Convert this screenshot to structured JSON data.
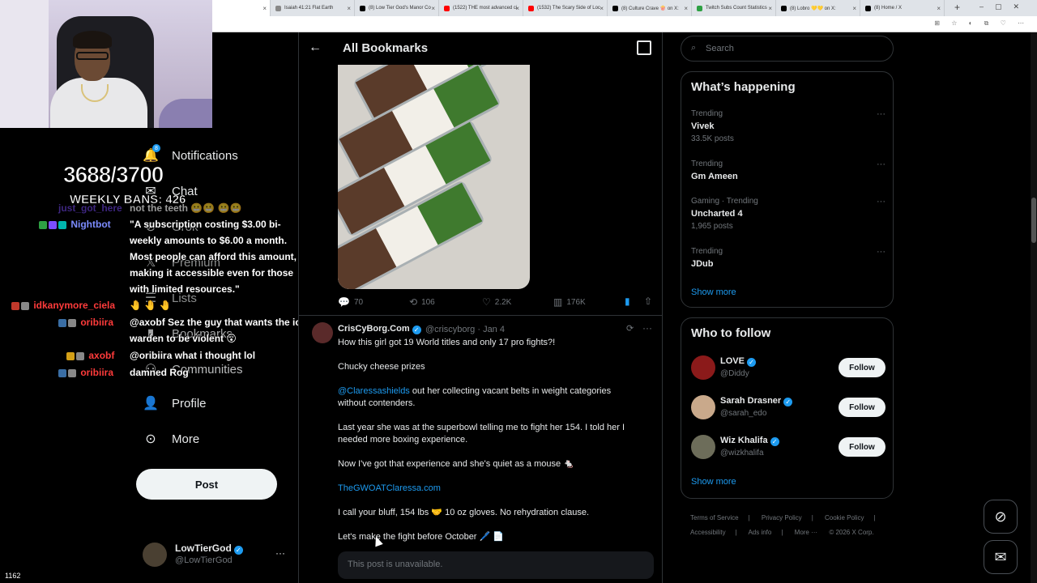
{
  "browser": {
    "tabs": [
      {
        "label": "",
        "active": true,
        "color": "#ffffff"
      },
      {
        "label": "Isaiah 41:21 Flat Earth",
        "color": "#888888"
      },
      {
        "label": "(8) Low Tier God's Manor Co",
        "color": "#000000"
      },
      {
        "label": "(1522) THE most advanced ci",
        "color": "#ff0000"
      },
      {
        "label": "(1532) The Scary Side of Loc",
        "color": "#ff0000"
      },
      {
        "label": "(8) Culture Crave 🍿 on X:",
        "color": "#000000"
      },
      {
        "label": "Twitch Subs Count Statistics",
        "color": "#2ea043"
      },
      {
        "label": "(8) Lobro 💛💛 on X:",
        "color": "#000000"
      },
      {
        "label": "(8) Home / X",
        "color": "#000000"
      }
    ]
  },
  "overlay": {
    "sub_count": "3688/3700",
    "weekly_bans": "WEEKLY BANS: 426",
    "viewers": "1162",
    "chat": [
      {
        "user": "just_got_here",
        "user_color": "#7c4dff",
        "message": "not the teeth 😬😬 😬😬"
      },
      {
        "user": "Nightbot",
        "user_color": "#7c8cff",
        "message": "\"A subscription costing $3.00 bi-"
      },
      {
        "user": "",
        "user_color": "#ffffff",
        "message": "weekly amounts to $6.00 a month."
      },
      {
        "user": "",
        "user_color": "#ffffff",
        "message": "Most people can afford this amount,"
      },
      {
        "user": "",
        "user_color": "#ffffff",
        "message": "making it accessible even for those"
      },
      {
        "user": "",
        "user_color": "#ffffff",
        "message": "with limited resources.\""
      },
      {
        "user": "idkanymore_ciela",
        "user_color": "#ff3b3b",
        "message": "🤚 🤚 🤚"
      },
      {
        "user": "oribiira",
        "user_color": "#ff3b3b",
        "message": "@axobf Sez the guy that wants the ice"
      },
      {
        "user": "",
        "user_color": "#ffffff",
        "message": "warden to be violent 😮"
      },
      {
        "user": "axobf",
        "user_color": "#ff3b3b",
        "message": "@oribiira what i thought lol"
      },
      {
        "user": "oribiira",
        "user_color": "#ff3b3b",
        "message": "damned Rog"
      }
    ]
  },
  "leftnav": {
    "notifications_badge": "8",
    "items": [
      {
        "label": "Notifications",
        "icon": "bell-icon"
      },
      {
        "label": "Chat",
        "icon": "mail-icon"
      },
      {
        "label": "Grok",
        "icon": "grok-icon"
      },
      {
        "label": "Premium",
        "icon": "x-logo-icon"
      },
      {
        "label": "Lists",
        "icon": "list-icon"
      },
      {
        "label": "Bookmarks",
        "icon": "bookmark-icon"
      },
      {
        "label": "Communities",
        "icon": "communities-icon"
      },
      {
        "label": "Profile",
        "icon": "person-icon"
      },
      {
        "label": "More",
        "icon": "more-circle-icon"
      }
    ],
    "post_label": "Post",
    "account": {
      "name": "LowTierGod",
      "handle": "@LowTierGod"
    }
  },
  "feed": {
    "title": "All Bookmarks",
    "first_post_stats": {
      "replies": "70",
      "reposts": "106",
      "likes": "2.2K",
      "views": "176K"
    },
    "tweet": {
      "name": "CrisCyBorg.Com",
      "handle": "@criscyborg · Jan 4",
      "lines": [
        {
          "text": "How this girl got 19 World titles and only 17 pro fights?!",
          "link": false
        },
        {
          "text": "Chucky cheese prizes",
          "link": false
        },
        {
          "text": "@Claressashields",
          "link": true,
          "rest": " out her collecting vacant belts in weight categories"
        },
        {
          "text": "without contenders.",
          "link": false
        },
        {
          "text": "Last year she was at the superbowl telling me to fight her 154. I told her I",
          "link": false
        },
        {
          "text": "needed more boxing experience.",
          "link": false
        },
        {
          "text": "Now I've got that experience and she's quiet as a mouse 🐁",
          "link": false
        },
        {
          "text": "TheGWOATClaressa.com",
          "link": true
        },
        {
          "text": "I call your bluff, 154 lbs 🤝 10 oz gloves. No rehydration clause.",
          "link": false
        },
        {
          "text": "Let's make the fight before October 🖊️ 📄",
          "link": false
        }
      ],
      "unavailable": "This post is unavailable."
    }
  },
  "right": {
    "search_placeholder": "Search",
    "happening_title": "What’s happening",
    "trends": [
      {
        "context": "Trending",
        "title": "Vivek",
        "posts": "33.5K posts"
      },
      {
        "context": "Trending",
        "title": "Gm Ameen",
        "posts": ""
      },
      {
        "context": "Gaming · Trending",
        "title": "Uncharted 4",
        "posts": "1,965 posts"
      },
      {
        "context": "Trending",
        "title": "JDub",
        "posts": ""
      }
    ],
    "show_more": "Show more",
    "wtf_title": "Who to follow",
    "who_to_follow": [
      {
        "name": "LOVE",
        "handle": "@Diddy",
        "color": "#8b1a1a"
      },
      {
        "name": "Sarah Drasner",
        "handle": "@sarah_edo",
        "color": "#c9a98b"
      },
      {
        "name": "Wiz Khalifa",
        "handle": "@wizkhalifa",
        "color": "#6d6d5a"
      }
    ],
    "follow_label": "Follow",
    "footer": [
      "Terms of Service",
      "|",
      "Privacy Policy",
      "|",
      "Cookie Policy",
      "|",
      "Accessibility",
      "|",
      "Ads info",
      "|",
      "More ···",
      "© 2026 X Corp."
    ]
  }
}
